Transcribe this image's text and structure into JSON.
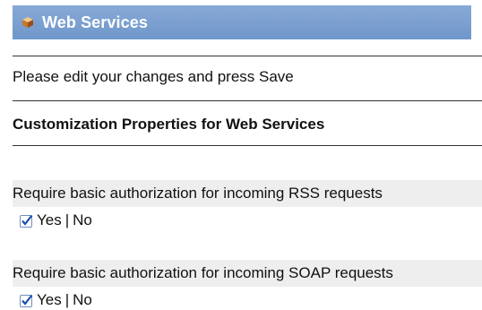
{
  "header": {
    "title": "Web Services",
    "icon": "cube-icon",
    "bar_color": "#7a9fd0"
  },
  "instruction_text": "Please edit your changes and press Save",
  "section_title": "Customization Properties for Web Services",
  "properties": [
    {
      "label": "Require basic authorization for incoming RSS requests",
      "checked": true,
      "yes_label": "Yes",
      "separator": "|",
      "no_label": "No"
    },
    {
      "label": "Require basic authorization for incoming SOAP requests",
      "checked": true,
      "yes_label": "Yes",
      "separator": "|",
      "no_label": "No"
    }
  ]
}
